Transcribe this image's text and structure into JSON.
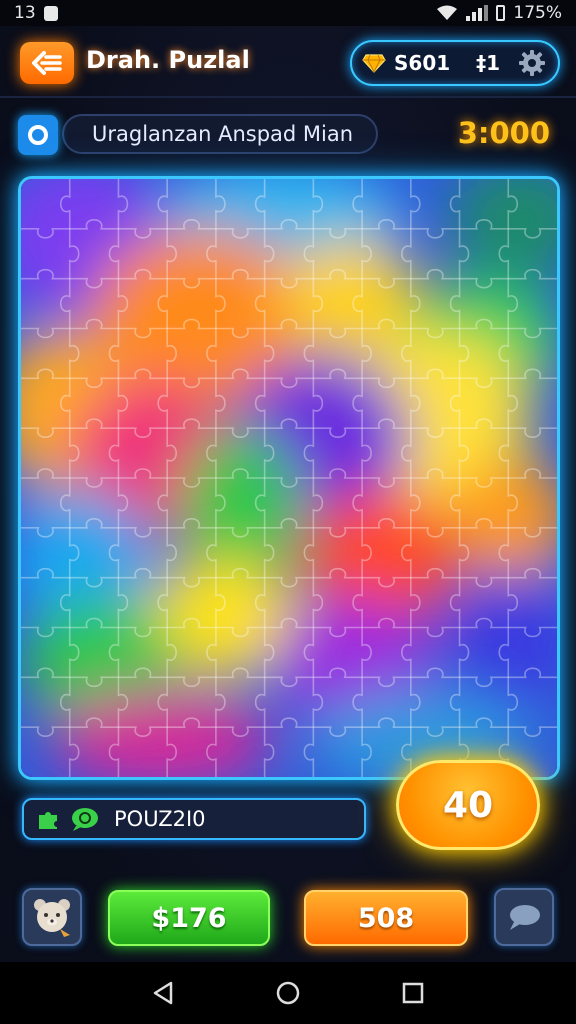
{
  "status_bar": {
    "time": "13",
    "battery": "175%"
  },
  "header": {
    "title": "Drah. Puzlal",
    "coins": "S601",
    "lives": "‡1"
  },
  "level": {
    "name": "Uraglanzan Anspad Mian",
    "timer": "3:000"
  },
  "board": {
    "cols": 11,
    "rows": 12
  },
  "hint": {
    "label": "POUZ2I0"
  },
  "score": {
    "value": "40"
  },
  "bottom": {
    "money": "$176",
    "count": "508"
  },
  "colors": {
    "accent_blue": "#39c8ff",
    "accent_orange": "#ff8a00",
    "accent_green": "#2fd62a",
    "timer_yellow": "#ffc21a"
  },
  "icons": {
    "back": "back-arrow-icon",
    "gem": "gem-icon",
    "gear": "gear-icon",
    "level": "level-badge-icon",
    "hint": "hint-icons",
    "avatar": "bear-avatar-icon",
    "chat": "chat-bubble-icon"
  }
}
